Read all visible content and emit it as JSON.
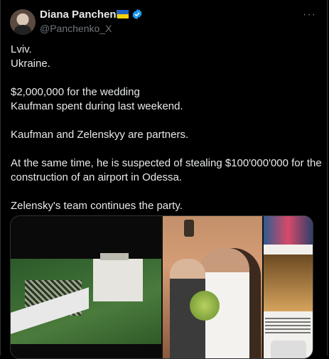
{
  "author": {
    "name": "Diana Panchenko",
    "handle": "@Panchenko_X"
  },
  "icons": {
    "flag": "ukraine-flag-icon",
    "verified": "verified-badge-icon",
    "more": "more-options-icon"
  },
  "more_label": "···",
  "tweet": {
    "lines": [
      "Lviv.",
      "Ukraine.",
      "",
      "$2,000,000 for the wedding",
      "Kaufman spent during last weekend.",
      "",
      "Kaufman and Zelenskyy are partners.",
      "",
      "At the same time, he is suspected of stealing $100'000'000 for the construction of an airport in Odessa.",
      "",
      "Zelensky's team continues the party."
    ]
  },
  "colors": {
    "background": "#000000",
    "text": "#e7e9ea",
    "muted": "#71767b",
    "verified": "#1d9bf0"
  }
}
